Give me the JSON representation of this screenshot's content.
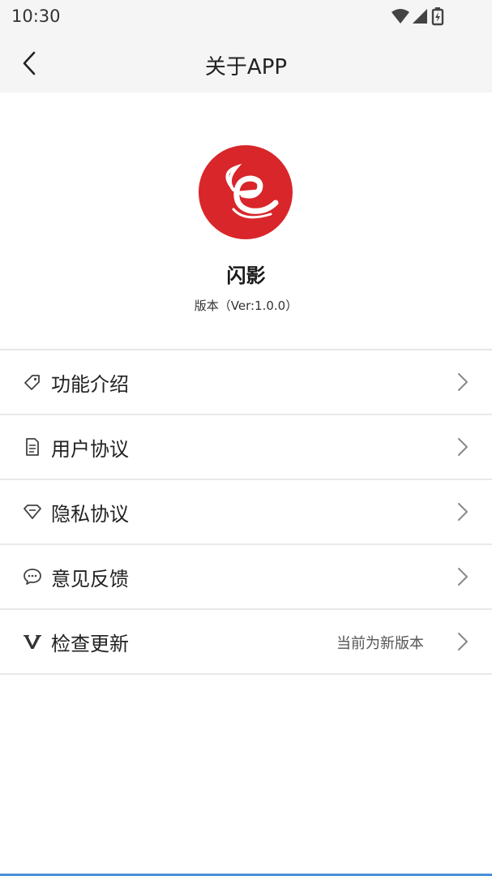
{
  "status_bar": {
    "time": "10:30",
    "icons": [
      "wifi-icon",
      "cell-signal-icon",
      "battery-charging-icon"
    ]
  },
  "navbar": {
    "back_icon": "chevron-left-icon",
    "title": "关于APP"
  },
  "app": {
    "logo": "app-logo",
    "logo_color": "#d8262b",
    "name": "闪影",
    "version": "版本（Ver:1.0.0）"
  },
  "menu": {
    "items": [
      {
        "icon": "tag-icon",
        "label": "功能介绍",
        "value": ""
      },
      {
        "icon": "document-icon",
        "label": "用户协议",
        "value": ""
      },
      {
        "icon": "diamond-icon",
        "label": "隐私协议",
        "value": ""
      },
      {
        "icon": "chat-bubble-icon",
        "label": "意见反馈",
        "value": ""
      },
      {
        "icon": "v-icon",
        "label": "检查更新",
        "value": "当前为新版本"
      }
    ],
    "chevron_icon": "chevron-right-icon"
  },
  "colors": {
    "bar_background": "#f5f5f5",
    "divider": "#e9e9e9",
    "text": "#222222",
    "accent_bottom": "#4a90d9"
  }
}
